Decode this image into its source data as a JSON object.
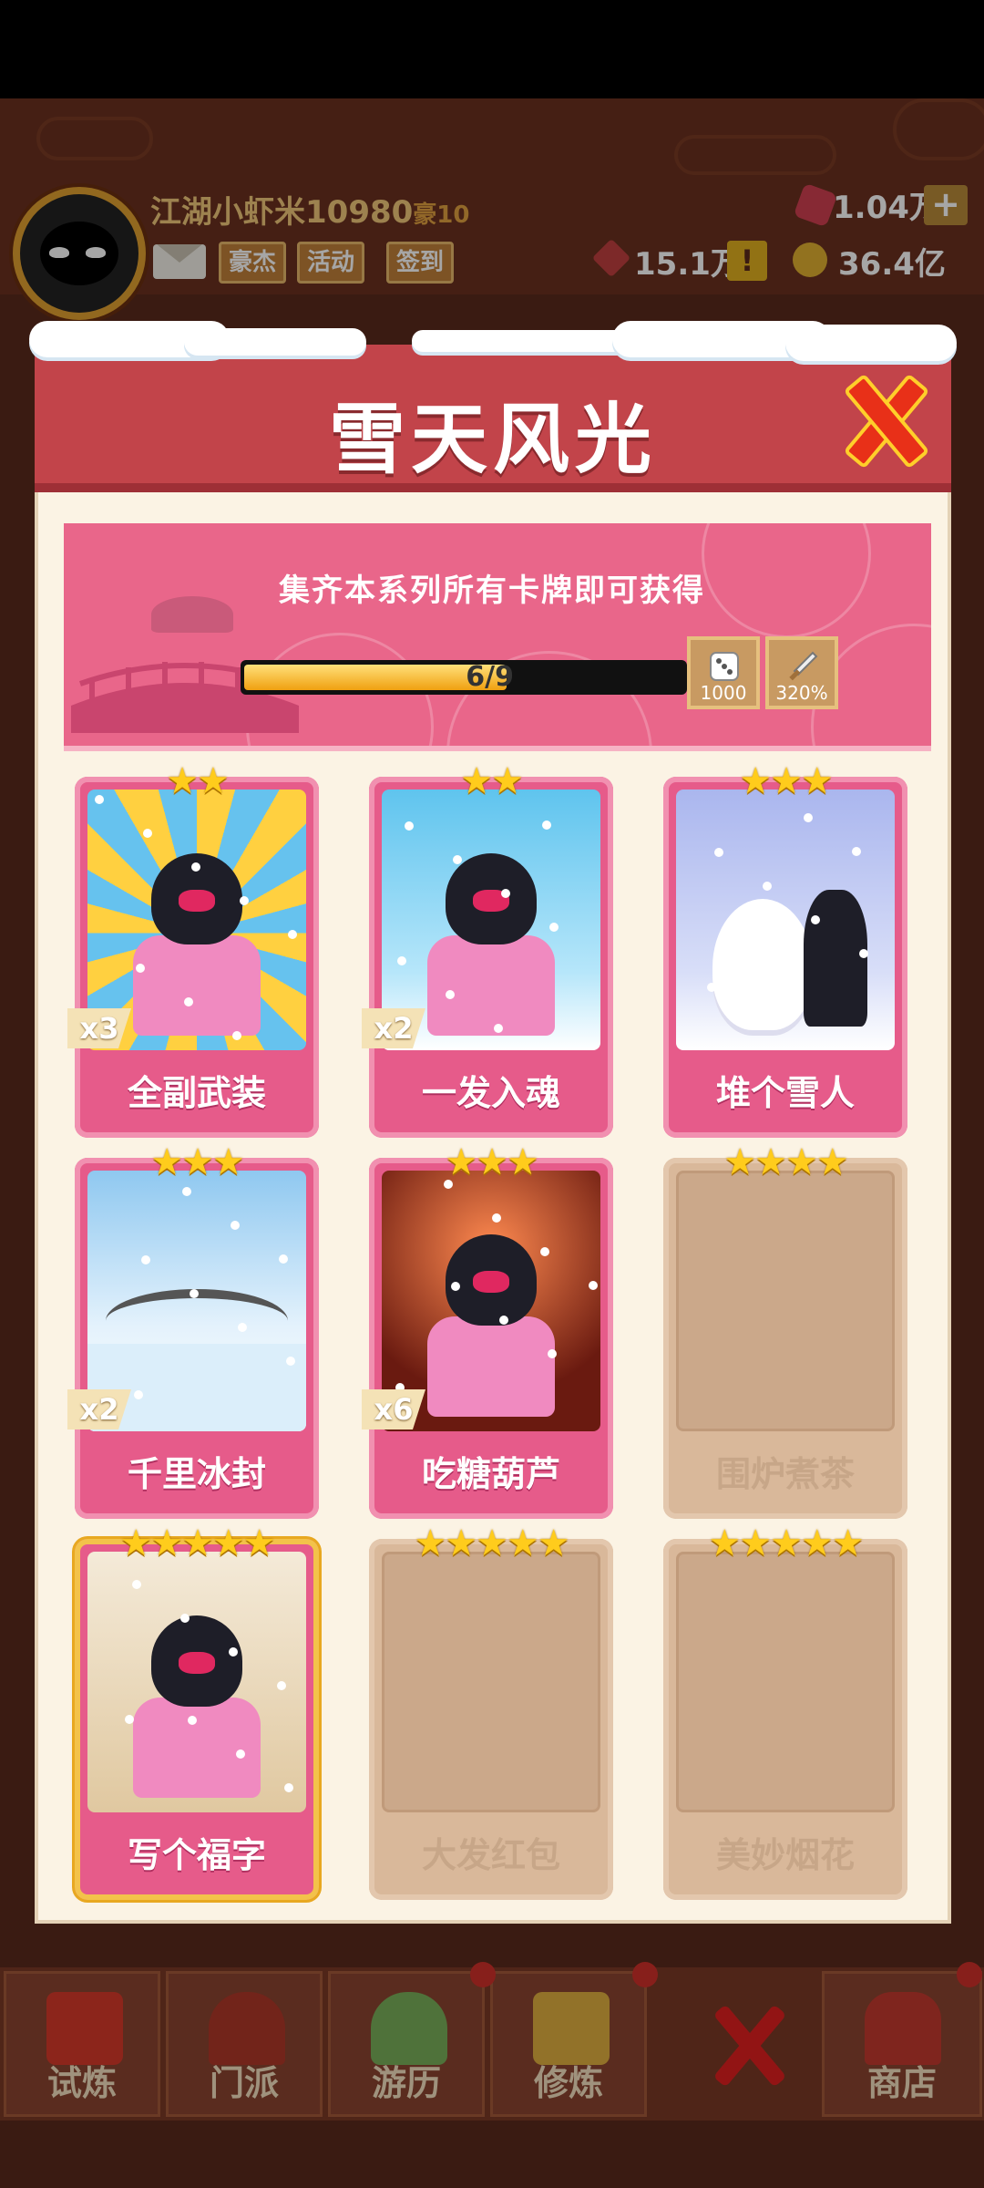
{
  "player": {
    "name": "江湖小虾米10980",
    "title_badge": "豪10",
    "buttons": [
      "豪杰",
      "活动",
      "签到"
    ]
  },
  "resources": {
    "gems": "1.04万",
    "tokens": "15.1万",
    "coins": "36.4亿",
    "plus_label": "+",
    "alert_label": "!"
  },
  "modal": {
    "title": "雪天风光",
    "banner_text": "集齐本系列所有卡牌即可获得",
    "progress": {
      "current": 6,
      "total": 9,
      "label": "6/9",
      "fraction": 0.667
    },
    "rewards": [
      {
        "icon": "dice-icon",
        "value": "1000"
      },
      {
        "icon": "sword-icon",
        "value": "320%"
      }
    ],
    "cards": [
      {
        "name": "全副武装",
        "stars": 2,
        "count": "x3",
        "owned": true
      },
      {
        "name": "一发入魂",
        "stars": 2,
        "count": "x2",
        "owned": true
      },
      {
        "name": "堆个雪人",
        "stars": 3,
        "count": "",
        "owned": true
      },
      {
        "name": "千里冰封",
        "stars": 3,
        "count": "x2",
        "owned": true
      },
      {
        "name": "吃糖葫芦",
        "stars": 3,
        "count": "x6",
        "owned": true
      },
      {
        "name": "围炉煮茶",
        "stars": 4,
        "count": "",
        "owned": false
      },
      {
        "name": "写个福字",
        "stars": 5,
        "count": "",
        "owned": true
      },
      {
        "name": "大发红包",
        "stars": 5,
        "count": "",
        "owned": false
      },
      {
        "name": "美妙烟花",
        "stars": 5,
        "count": "",
        "owned": false
      }
    ]
  },
  "bottom_nav": [
    "试炼",
    "门派",
    "游历",
    "修炼",
    "商店"
  ],
  "colors": {
    "modal_header": "#c2444a",
    "card_pink": "#e65b8a",
    "card_locked": "#d9b89a",
    "star": "#ffcc1c",
    "progress": "#f0a010"
  }
}
